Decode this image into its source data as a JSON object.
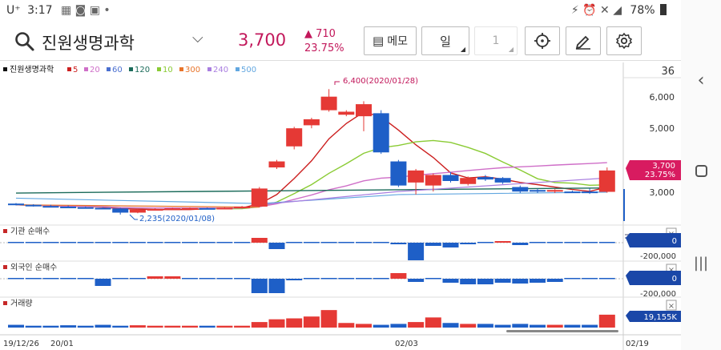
{
  "status": {
    "carrier": "U⁺",
    "time": "3:17",
    "battery": "78%"
  },
  "header": {
    "stock_name": "진원생명과학",
    "price": "3,700",
    "change_arrow": "▲",
    "change": "710",
    "change_pct": "23.75%",
    "memo_label": "메모",
    "period_label": "일",
    "period_count": "1"
  },
  "legend": {
    "title": "진원생명과학",
    "ma": [
      {
        "label": "5",
        "color": "#cc1f1f"
      },
      {
        "label": "20",
        "color": "#cf6fc8"
      },
      {
        "label": "60",
        "color": "#4a6fd0"
      },
      {
        "label": "120",
        "color": "#1b6b5a"
      },
      {
        "label": "10",
        "color": "#8acb34"
      },
      {
        "label": "300",
        "color": "#e8742a"
      },
      {
        "label": "240",
        "color": "#a97ee0"
      },
      {
        "label": "500",
        "color": "#62a7e0"
      }
    ]
  },
  "axis": {
    "price_ticks": [
      "6,000",
      "5,000",
      "3,000"
    ],
    "top_value": "36",
    "inst_tick": "-200,000",
    "foreign_tick": "-200,000",
    "inst_badge": "0",
    "foreign_badge": "0",
    "volume_badge": "19,155K",
    "current_price": "3,700",
    "current_pct": "23.75%",
    "dates": [
      "19/12/26",
      "20/01",
      "02/03",
      "02/19"
    ]
  },
  "annotations": {
    "high": "6,400(2020/01/28)",
    "low": "2,235(2020/01/08)"
  },
  "panels": {
    "institution": "기관 순매수",
    "foreign": "외국인 순매수",
    "volume": "거래량"
  },
  "colors": {
    "up": "#e53935",
    "down": "#1e5fc7",
    "accent": "#c2185b",
    "price_badge": "#d81b60",
    "badge_blue": "#1a47a8"
  },
  "chart_data": {
    "type": "candlestick",
    "title": "진원생명과학",
    "candles": [
      {
        "o": 2600,
        "c": 2560,
        "h": 2620,
        "l": 2540
      },
      {
        "o": 2560,
        "c": 2520,
        "h": 2580,
        "l": 2500
      },
      {
        "o": 2520,
        "c": 2500,
        "h": 2560,
        "l": 2480
      },
      {
        "o": 2500,
        "c": 2480,
        "h": 2540,
        "l": 2460
      },
      {
        "o": 2480,
        "c": 2460,
        "h": 2500,
        "l": 2440
      },
      {
        "o": 2460,
        "c": 2440,
        "h": 2480,
        "l": 2420
      },
      {
        "o": 2440,
        "c": 2300,
        "h": 2460,
        "l": 2235
      },
      {
        "o": 2300,
        "c": 2400,
        "h": 2420,
        "l": 2280
      },
      {
        "o": 2400,
        "c": 2420,
        "h": 2440,
        "l": 2380
      },
      {
        "o": 2420,
        "c": 2440,
        "h": 2460,
        "l": 2400
      },
      {
        "o": 2440,
        "c": 2450,
        "h": 2470,
        "l": 2420
      },
      {
        "o": 2450,
        "c": 2440,
        "h": 2470,
        "l": 2420
      },
      {
        "o": 2440,
        "c": 2460,
        "h": 2480,
        "l": 2420
      },
      {
        "o": 2460,
        "c": 2500,
        "h": 2520,
        "l": 2440
      },
      {
        "o": 2500,
        "c": 3100,
        "h": 3150,
        "l": 2480
      },
      {
        "o": 3800,
        "c": 4000,
        "h": 4050,
        "l": 3750
      },
      {
        "o": 4500,
        "c": 5100,
        "h": 5150,
        "l": 4400
      },
      {
        "o": 5200,
        "c": 5400,
        "h": 5450,
        "l": 5100
      },
      {
        "o": 5700,
        "c": 6150,
        "h": 6400,
        "l": 5650
      },
      {
        "o": 5550,
        "c": 5650,
        "h": 5700,
        "l": 5500
      },
      {
        "o": 5500,
        "c": 5900,
        "h": 6000,
        "l": 5000
      },
      {
        "o": 5600,
        "c": 4300,
        "h": 5700,
        "l": 4250
      },
      {
        "o": 4000,
        "c": 3200,
        "h": 4050,
        "l": 3150
      },
      {
        "o": 3300,
        "c": 3700,
        "h": 3750,
        "l": 2900
      },
      {
        "o": 3200,
        "c": 3550,
        "h": 3600,
        "l": 3000
      },
      {
        "o": 3550,
        "c": 3350,
        "h": 3650,
        "l": 3300
      },
      {
        "o": 3250,
        "c": 3450,
        "h": 3500,
        "l": 3200
      },
      {
        "o": 3480,
        "c": 3400,
        "h": 3550,
        "l": 3350
      },
      {
        "o": 3450,
        "c": 3300,
        "h": 3480,
        "l": 3250
      },
      {
        "o": 3150,
        "c": 3000,
        "h": 3200,
        "l": 2950
      },
      {
        "o": 3050,
        "c": 3000,
        "h": 3100,
        "l": 2950
      },
      {
        "o": 3000,
        "c": 3050,
        "h": 3080,
        "l": 2950
      },
      {
        "o": 3000,
        "c": 2990,
        "h": 3030,
        "l": 2970
      },
      {
        "o": 3000,
        "c": 2990,
        "h": 3100,
        "l": 2920
      },
      {
        "o": 2990,
        "c": 3700,
        "h": 3800,
        "l": 2960
      }
    ],
    "ylim": [
      2100,
      6700
    ],
    "institution": [
      0,
      0,
      0,
      0,
      0,
      0,
      0,
      0,
      0,
      0,
      0,
      0,
      0,
      0,
      60000,
      -80000,
      0,
      0,
      0,
      0,
      0,
      0,
      -20000,
      -220000,
      -40000,
      -60000,
      -20000,
      0,
      20000,
      -30000,
      0,
      0,
      0,
      0,
      0
    ],
    "foreign": [
      0,
      0,
      0,
      0,
      0,
      -90000,
      0,
      0,
      30000,
      30000,
      0,
      0,
      0,
      0,
      -180000,
      -180000,
      -20000,
      0,
      0,
      0,
      0,
      0,
      70000,
      -40000,
      0,
      -50000,
      -70000,
      -70000,
      -50000,
      -60000,
      -50000,
      -40000,
      0,
      0,
      0
    ],
    "volume": [
      3000,
      2000,
      2000,
      2500,
      2000,
      3000,
      2000,
      2500,
      2000,
      2000,
      2000,
      2000,
      2000,
      2000,
      6000,
      9000,
      10000,
      12000,
      19000,
      5000,
      4000,
      3000,
      4000,
      6000,
      11000,
      5000,
      4000,
      4000,
      3000,
      4000,
      3000,
      3000,
      3000,
      3000,
      14000
    ]
  }
}
